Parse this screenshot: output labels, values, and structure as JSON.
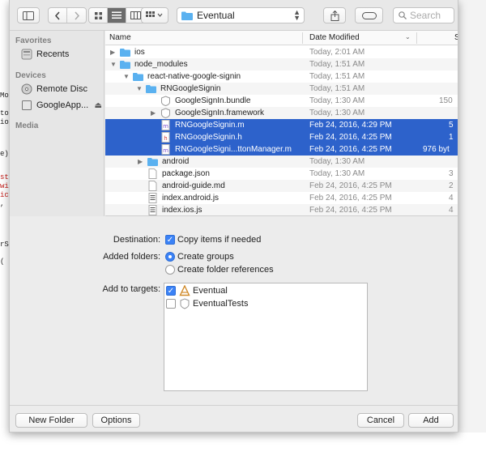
{
  "background_code": {
    "lines": [
      {
        "text": "Mo",
        "color": "#222222"
      },
      {
        "text": "ton",
        "color": "#222222"
      },
      {
        "text": "io",
        "color": "#222222"
      },
      {
        "text": "e)",
        "color": "#222222"
      },
      {
        "text": "st",
        "color": "#c41a16"
      },
      {
        "text": "wi",
        "color": "#c41a16"
      },
      {
        "text": "ic",
        "color": "#c41a16"
      },
      {
        "text": ",",
        "color": "#222222"
      },
      {
        "text": "rS",
        "color": "#222222"
      },
      {
        "text": "(",
        "color": "#222222"
      }
    ]
  },
  "toolbar": {
    "sidebar_toggle_icon": "sidebar-toggle-icon",
    "back_icon": "chevron-left-icon",
    "forward_icon": "chevron-right-icon",
    "view_icons": [
      "icon-view-icon",
      "list-view-icon",
      "column-view-icon"
    ],
    "active_view": 1,
    "arrange_icon": "grid-arrange-icon",
    "location": "Eventual",
    "share_icon": "share-icon",
    "tag_icon": "tag-icon",
    "search_placeholder": "Search"
  },
  "sidebar": {
    "sections": [
      {
        "title": "Favorites",
        "items": [
          {
            "label": "Recents",
            "icon": "recents-icon"
          }
        ]
      },
      {
        "title": "Devices",
        "items": [
          {
            "label": "Remote Disc",
            "icon": "disc-icon"
          },
          {
            "label": "GoogleApp...",
            "icon": "drive-icon",
            "eject": "⏏"
          }
        ]
      },
      {
        "title": "Media",
        "items": []
      }
    ]
  },
  "file_list": {
    "columns": {
      "name": "Name",
      "date": "Date Modified",
      "size": "S"
    },
    "rows": [
      {
        "depth": 0,
        "disclosure": "▶",
        "type": "folder",
        "name": "ios",
        "date": "Today, 2:01 AM",
        "size": "",
        "selected": false
      },
      {
        "depth": 0,
        "disclosure": "▼",
        "type": "folder",
        "name": "node_modules",
        "date": "Today, 1:51 AM",
        "size": "",
        "selected": false
      },
      {
        "depth": 1,
        "disclosure": "▼",
        "type": "folder",
        "name": "react-native-google-signin",
        "date": "Today, 1:51 AM",
        "size": "",
        "selected": false
      },
      {
        "depth": 2,
        "disclosure": "▼",
        "type": "folder",
        "name": "RNGoogleSignin",
        "date": "Today, 1:51 AM",
        "size": "",
        "selected": false
      },
      {
        "depth": 3,
        "disclosure": "",
        "type": "bundle",
        "name": "GoogleSignIn.bundle",
        "date": "Today, 1:30 AM",
        "size": "150",
        "selected": false
      },
      {
        "depth": 3,
        "disclosure": "▶",
        "type": "bundle",
        "name": "GoogleSignIn.framework",
        "date": "Today, 1:30 AM",
        "size": "",
        "selected": false
      },
      {
        "depth": 3,
        "disclosure": "",
        "type": "m",
        "name": "RNGoogleSignin.m",
        "date": "Feb 24, 2016, 4:29 PM",
        "size": "5",
        "selected": true
      },
      {
        "depth": 3,
        "disclosure": "",
        "type": "h",
        "name": "RNGoogleSignin.h",
        "date": "Feb 24, 2016, 4:25 PM",
        "size": "1",
        "selected": true
      },
      {
        "depth": 3,
        "disclosure": "",
        "type": "m",
        "name": "RNGoogleSigni...ttonManager.m",
        "date": "Feb 24, 2016, 4:25 PM",
        "size": "976 byt",
        "selected": true
      },
      {
        "depth": 2,
        "disclosure": "▶",
        "type": "folder",
        "name": "android",
        "date": "Today, 1:30 AM",
        "size": "",
        "selected": false
      },
      {
        "depth": 2,
        "disclosure": "",
        "type": "doc",
        "name": "package.json",
        "date": "Today, 1:30 AM",
        "size": "3",
        "selected": false
      },
      {
        "depth": 2,
        "disclosure": "",
        "type": "doc",
        "name": "android-guide.md",
        "date": "Feb 24, 2016, 4:25 PM",
        "size": "2",
        "selected": false
      },
      {
        "depth": 2,
        "disclosure": "",
        "type": "js",
        "name": "index.android.js",
        "date": "Feb 24, 2016, 4:25 PM",
        "size": "4",
        "selected": false
      },
      {
        "depth": 2,
        "disclosure": "",
        "type": "js",
        "name": "index.ios.js",
        "date": "Feb 24, 2016, 4:25 PM",
        "size": "4",
        "selected": false
      }
    ]
  },
  "options": {
    "destination_label": "Destination:",
    "copy_items_label": "Copy items if needed",
    "copy_items_checked": true,
    "added_folders_label": "Added folders:",
    "create_groups_label": "Create groups",
    "create_refs_label": "Create folder references",
    "selected_folder_option": "groups",
    "targets_label": "Add to targets:",
    "targets": [
      {
        "name": "Eventual",
        "checked": true,
        "icon": "app-target-icon"
      },
      {
        "name": "EventualTests",
        "checked": false,
        "icon": "test-target-icon"
      }
    ]
  },
  "buttons": {
    "new_folder": "New Folder",
    "options": "Options",
    "cancel": "Cancel",
    "add": "Add"
  },
  "colors": {
    "selection": "#2d62cb",
    "accent": "#3b82f6",
    "folder": "#5ab1f0"
  }
}
